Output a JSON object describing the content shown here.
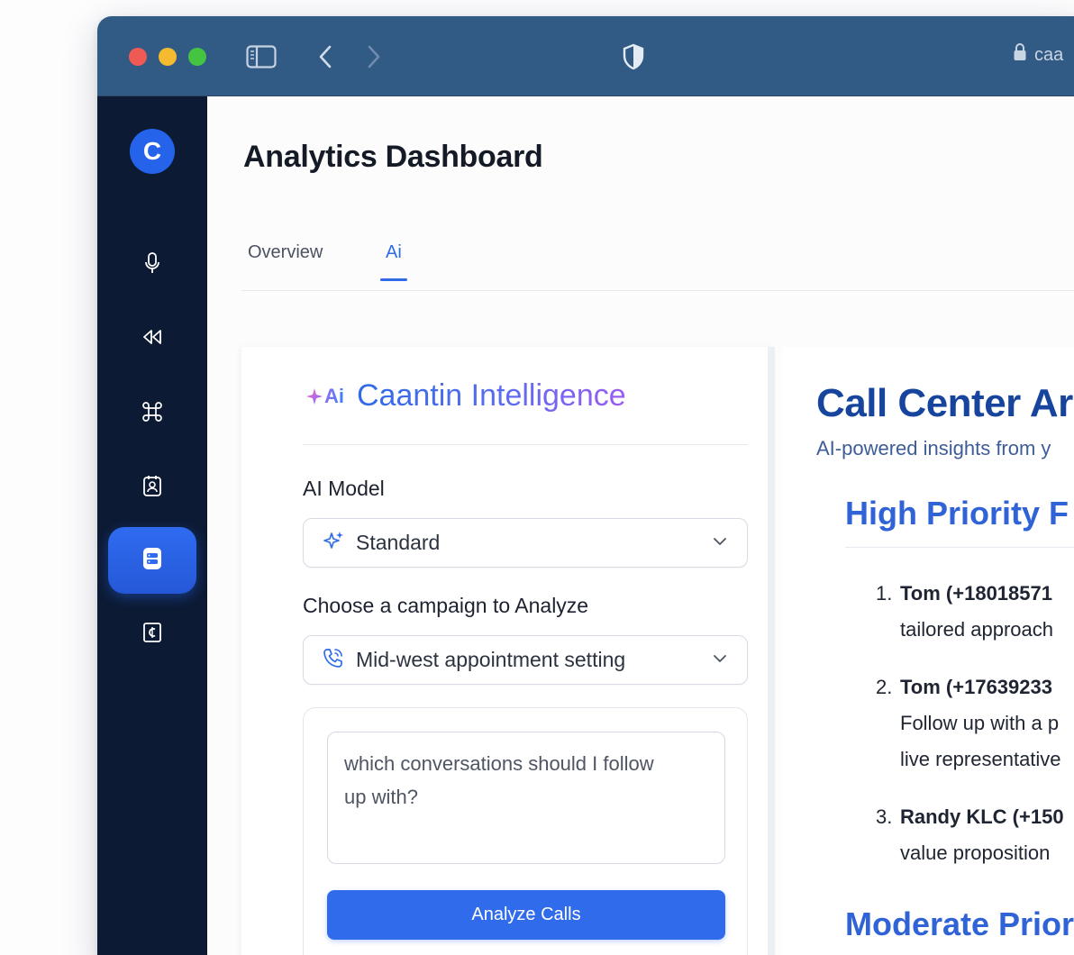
{
  "browser": {
    "url_text": "caa"
  },
  "app": {
    "logo_letter": "C",
    "page_title": "Analytics Dashboard",
    "tabs": [
      {
        "label": "Overview"
      },
      {
        "label": "Ai"
      }
    ],
    "active_tab": "Ai",
    "sidebar_icons": [
      "microphone-icon",
      "rewind-icon",
      "command-icon",
      "contact-card-icon",
      "server-icon",
      "credit-icon"
    ]
  },
  "intelligence": {
    "badge": "Ai",
    "title": "Caantin Intelligence",
    "model_label": "AI Model",
    "model_value": "Standard",
    "campaign_label": "Choose a campaign to Analyze",
    "campaign_value": "Mid-west appointment setting",
    "prompt_line1": "which conversations should I follow",
    "prompt_line2": "up with?",
    "analyze_button": "Analyze Calls"
  },
  "report": {
    "title": "Call Center Ar",
    "subtitle": "AI-powered insights from y",
    "high_priority_heading": "High Priority F",
    "items": [
      {
        "number": "1.",
        "name": "Tom (+18018571",
        "line2": "tailored approach",
        "line3": ""
      },
      {
        "number": "2.",
        "name": "Tom (+17639233",
        "line2": "Follow up with a p",
        "line3": "live representative"
      },
      {
        "number": "3.",
        "name": "Randy KLC (+150",
        "line2": "value proposition",
        "line3": ""
      }
    ],
    "moderate_priority_heading": "Moderate Prior"
  },
  "colors": {
    "titlebar": "#315a85",
    "sidebar": "#0c1a33",
    "accent": "#2f6bea",
    "report_heading": "#17459e"
  }
}
